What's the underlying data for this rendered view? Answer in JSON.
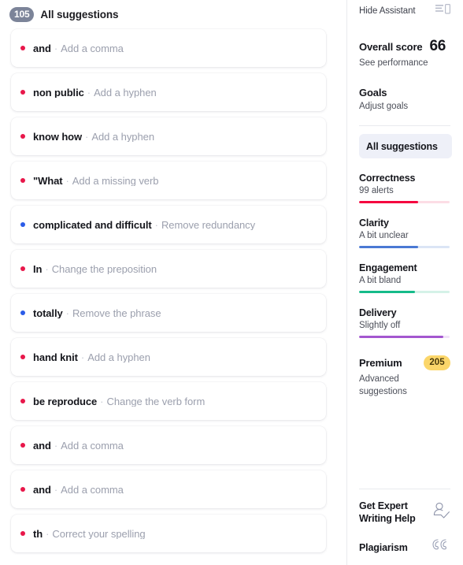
{
  "suggestions_panel": {
    "count_badge": "105",
    "title": "All suggestions",
    "separator": "·",
    "items": [
      {
        "term": "and",
        "action": "Add a comma",
        "dot": "red"
      },
      {
        "term": "non public",
        "action": "Add a hyphen",
        "dot": "red"
      },
      {
        "term": "know how",
        "action": "Add a hyphen",
        "dot": "red"
      },
      {
        "term": "\"What",
        "action": "Add a missing verb",
        "dot": "red"
      },
      {
        "term": "complicated and difficult",
        "action": "Remove redundancy",
        "dot": "blue"
      },
      {
        "term": "In",
        "action": "Change the preposition",
        "dot": "red"
      },
      {
        "term": "totally",
        "action": "Remove the phrase",
        "dot": "blue"
      },
      {
        "term": "hand knit",
        "action": "Add a hyphen",
        "dot": "red"
      },
      {
        "term": "be reproduce",
        "action": "Change the verb form",
        "dot": "red"
      },
      {
        "term": "and",
        "action": "Add a comma",
        "dot": "red"
      },
      {
        "term": "and",
        "action": "Add a comma",
        "dot": "red"
      },
      {
        "term": "th",
        "action": "Correct your spelling",
        "dot": "red"
      }
    ]
  },
  "sidebar": {
    "hide_assistant_label": "Hide Assistant",
    "panel_icon": "panel-layout-icon",
    "overall": {
      "label": "Overall score",
      "score": "66",
      "sub": "See performance"
    },
    "goals": {
      "label": "Goals",
      "sub": "Adjust goals"
    },
    "all_suggestions_label": "All suggestions",
    "metrics": [
      {
        "name": "Correctness",
        "sub": "99 alerts",
        "percent": 65,
        "color": "#f5053f",
        "track": "#fcdde5"
      },
      {
        "name": "Clarity",
        "sub": "A bit unclear",
        "percent": 65,
        "color": "#4a79d4",
        "track": "#dbe5f5"
      },
      {
        "name": "Engagement",
        "sub": "A bit bland",
        "percent": 62,
        "color": "#15bb8a",
        "track": "#d5f2e8"
      },
      {
        "name": "Delivery",
        "sub": "Slightly off",
        "percent": 93,
        "color": "#a457cf",
        "track": "#f1e2f8"
      }
    ],
    "premium": {
      "label": "Premium",
      "badge": "205",
      "sub": "Advanced suggestions",
      "badge_color": "#fbd66a"
    },
    "footer_links": [
      {
        "label": "Get Expert Writing Help",
        "icon": "person-check-icon"
      },
      {
        "label": "Plagiarism",
        "icon": "quotation-marks-icon"
      }
    ]
  }
}
